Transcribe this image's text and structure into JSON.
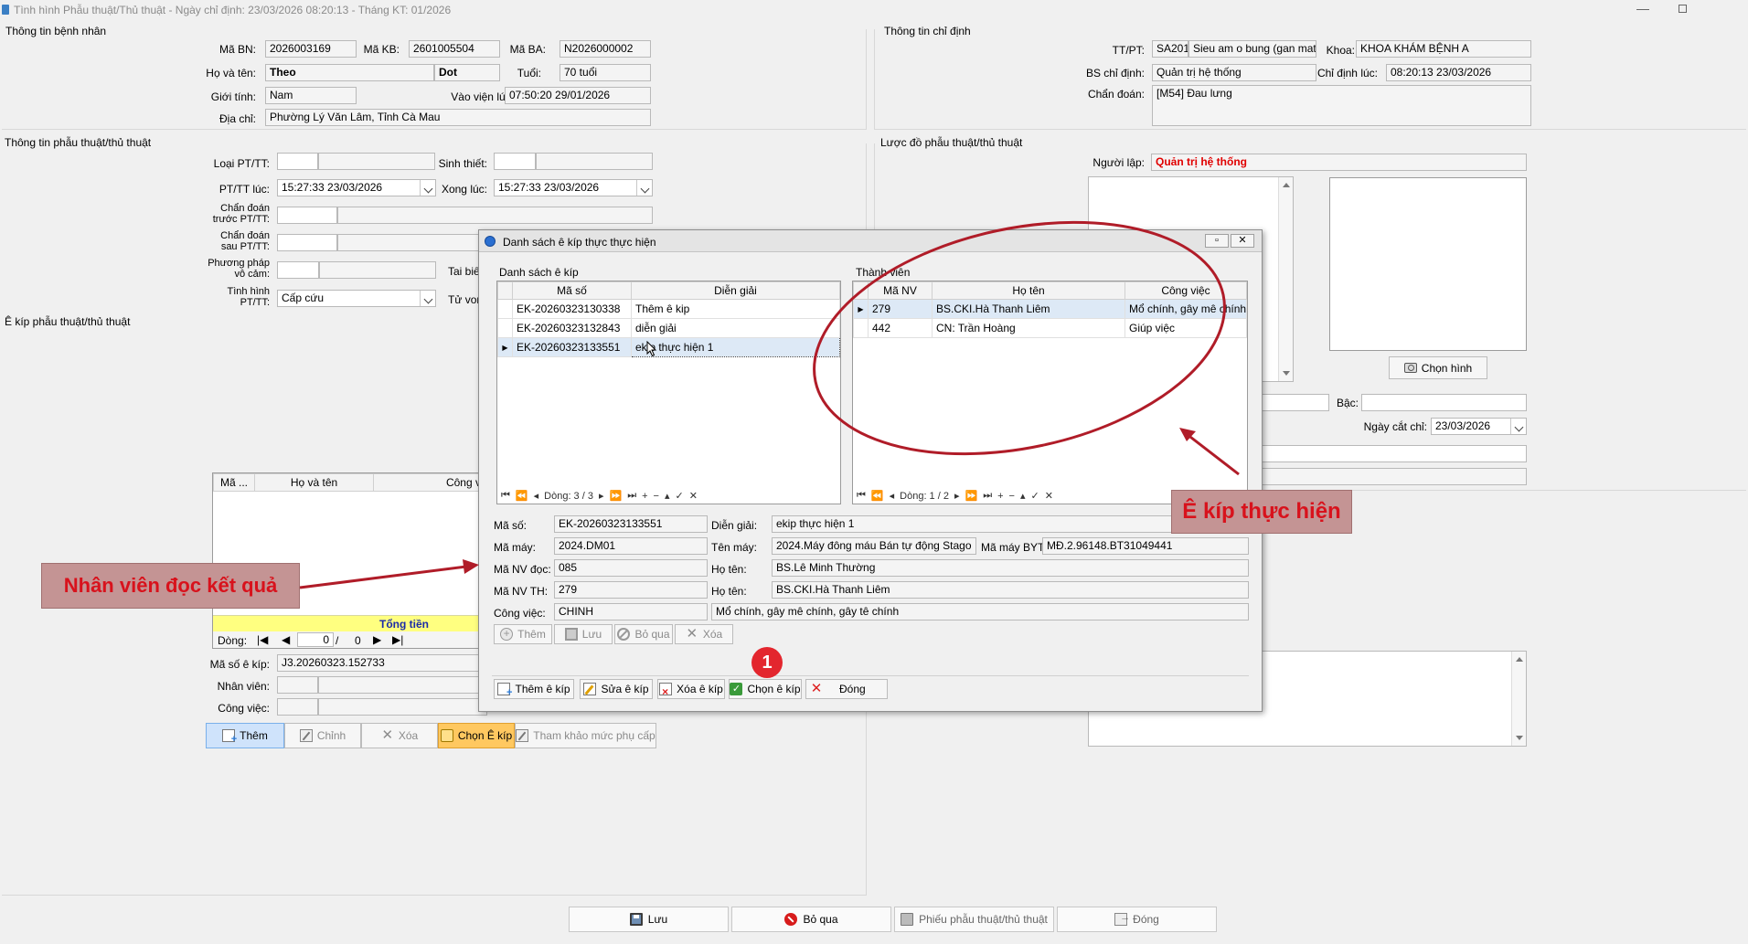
{
  "window": {
    "title": "Tình hình Phẫu thuật/Thủ thuật - Ngày chỉ định: 23/03/2026 08:20:13 - Tháng KT: 01/2026"
  },
  "patient": {
    "section_title": "Thông tin bệnh nhân",
    "ma_bn_label": "Mã BN:",
    "ma_bn": "2026003169",
    "ma_kb_label": "Mã KB:",
    "ma_kb": "2601005504",
    "ma_ba_label": "Mã BA:",
    "ma_ba": "N2026000002",
    "ho_ten_label": "Họ và tên:",
    "ho": "Theo",
    "ten": "Dot",
    "tuoi_label": "Tuổi:",
    "tuoi": "70 tuổi",
    "gioi_tinh_label": "Giới tính:",
    "gioi_tinh": "Nam",
    "vao_vien_label": "Vào viện lúc:",
    "vao_vien": "07:50:20 29/01/2026",
    "dia_chi_label": "Địa chỉ:",
    "dia_chi": "Phường Lý Văn Lâm, Tỉnh Cà Mau"
  },
  "order": {
    "section_title": "Thông tin chỉ định",
    "tt_pt_label": "TT/PT:",
    "tt_pt_code": "SA201",
    "tt_pt_name": "Sieu am o bung (gan mat, tụ",
    "khoa_label": "Khoa:",
    "khoa": "KHOA KHÁM BỆNH A",
    "bs_label": "BS chỉ định:",
    "bs": "Quản trị hệ thống",
    "chi_dinh_luc_label": "Chỉ định lúc:",
    "chi_dinh_luc": "08:20:13 23/03/2026",
    "chan_doan_label": "Chẩn đoán:",
    "chan_doan": "[M54] Đau lưng"
  },
  "surgery": {
    "section_title": "Thông tin phẫu thuật/thủ thuật",
    "loai_label": "Loại PT/TT:",
    "sinh_thiet_label": "Sinh thiết:",
    "pttt_luc_label": "PT/TT lúc:",
    "pttt_luc": "15:27:33 23/03/2026",
    "xong_luc_label": "Xong lúc:",
    "xong_luc": "15:27:33 23/03/2026",
    "chan_doan_truoc_l1": "Chẩn đoán",
    "chan_doan_truoc_l2": "trước PT/TT:",
    "chan_doan_sau_l1": "Chẩn đoán",
    "chan_doan_sau_l2": "sau PT/TT:",
    "phuong_phap_l1": "Phương pháp",
    "phuong_phap_l2": "vô cảm:",
    "tai_bien_label": "Tai biế",
    "tinh_hinh_l1": "Tình hình",
    "tinh_hinh_l2": "PT/TT:",
    "tinh_hinh": "Cấp cứu",
    "tu_vong_label": "Tử von"
  },
  "diagram": {
    "section_title": "Lược đồ phẫu thuật/thủ thuật",
    "nguoi_lap_label": "Người lập:",
    "nguoi_lap": "Quản trị hệ thống",
    "chon_hinh": "Chọn hình",
    "bac_label": "Bậc:",
    "ngay_cat_chi_label": "Ngày cắt chỉ:",
    "ngay_cat_chi": "23/03/2026"
  },
  "team_left": {
    "section_title": "Ê kíp phẫu thuật/thủ thuật",
    "col_ma": "Mã ...",
    "col_ho_ten": "Họ và tên",
    "col_cong_viec": "Công v",
    "tong_tien": "Tổng tiền",
    "dong_label": "Dòng:",
    "dong_current": "0",
    "dong_total": "0",
    "ma_so_ekip_label": "Mã số ê kíp:",
    "ma_so_ekip": "J3.20260323.152733",
    "nhan_vien_label": "Nhân viên:",
    "cong_viec_label": "Công việc:",
    "btn_them": "Thêm",
    "btn_chinh": "Chỉnh",
    "btn_xoa": "Xóa",
    "btn_chon_ekip": "Chọn Ê kíp",
    "btn_tham_khao": "Tham khảo mức phụ cấp"
  },
  "dialog": {
    "title": "Danh sách ê kíp thực thực hiện",
    "list_group": "Danh sách ê kíp",
    "col_ma_so": "Mã số",
    "col_dien_giai": "Diễn giải",
    "ekips": [
      {
        "ma_so": "EK-20260323130338",
        "dien_giai": "Thêm ê kip"
      },
      {
        "ma_so": "EK-20260323132843",
        "dien_giai": "diễn giải"
      },
      {
        "ma_so": "EK-20260323133551",
        "dien_giai": "ekip thực hiện 1"
      }
    ],
    "nav_left": "Dòng: 3 / 3",
    "members_group": "Thành viên",
    "col_ma_nv": "Mã NV",
    "col_ho_ten": "Họ tên",
    "col_cong_viec": "Công việc",
    "members": [
      {
        "ma_nv": "279",
        "ho_ten": "BS.CKI.Hà Thanh Liêm",
        "cong_viec": "Mổ chính, gây mê chính,..."
      },
      {
        "ma_nv": "442",
        "ho_ten": "CN: Trần Hoàng",
        "cong_viec": "Giúp việc"
      }
    ],
    "nav_right": "Dòng: 1 / 2",
    "detail": {
      "ma_so_label": "Mã số:",
      "ma_so": "EK-20260323133551",
      "dien_giai_label": "Diễn giải:",
      "dien_giai": "ekip thực hiện 1",
      "ma_may_label": "Mã máy:",
      "ma_may": "2024.DM01",
      "ten_may_label": "Tên máy:",
      "ten_may": "2024.Máy đông máu Bán tự động Stago",
      "ma_may_byt_label": "Mã máy BYT:",
      "ma_may_byt": "MĐ.2.96148.BT31049441",
      "ma_nv_doc_label": "Mã NV đọc:",
      "ma_nv_doc": "085",
      "ho_ten1_label": "Họ tên:",
      "ho_ten1": "BS.Lê Minh Thường",
      "ma_nv_th_label": "Mã NV TH:",
      "ma_nv_th": "279",
      "ho_ten2_label": "Họ tên:",
      "ho_ten2": "BS.CKI.Hà Thanh Liêm",
      "cong_viec_label": "Công việc:",
      "cong_viec_code": "CHINH",
      "cong_viec": "Mổ chính, gây mê chính, gây tê chính"
    },
    "btn_them": "Thêm",
    "btn_luu": "Lưu",
    "btn_bo_qua": "Bỏ qua",
    "btn_xoa": "Xóa",
    "btn_them_ekip": "Thêm ê kíp",
    "btn_sua_ekip": "Sửa ê kíp",
    "btn_xoa_ekip": "Xóa  ê kíp",
    "btn_chon_ekip": "Chọn  ê kíp",
    "btn_dong": "Đóng"
  },
  "annotations": {
    "ekip_label": "Ê kíp thực hiện",
    "nhan_vien_label": "Nhân viên đọc kết quả",
    "step_number": "1",
    "color": "#b01c28"
  },
  "footer": {
    "btn_luu": "Lưu",
    "btn_bo_qua": "Bỏ qua",
    "btn_phieu": "Phiếu phẫu thuật/thủ thuật",
    "btn_dong": "Đóng"
  }
}
